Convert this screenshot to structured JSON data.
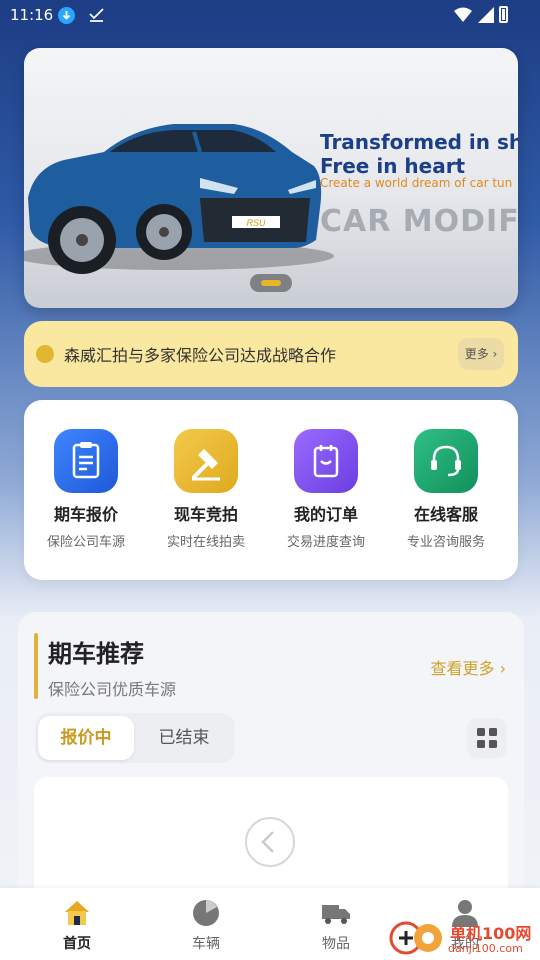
{
  "status_bar": {
    "time": "11:16"
  },
  "banner": {
    "title_line1": "Transformed in shap",
    "title_line2": "Free in heart",
    "subtitle": "Create a world dream of car tun",
    "watermark": "CAR MODIFIC",
    "plate": "RSU"
  },
  "notice": {
    "text": "森威汇拍与多家保险公司达成战略合作",
    "more": "更多 ›"
  },
  "quick_actions": [
    {
      "title": "期车报价",
      "subtitle": "保险公司车源",
      "icon": "clipboard-quote-icon",
      "color": "#2f6ff0"
    },
    {
      "title": "现车竞拍",
      "subtitle": "实时在线拍卖",
      "icon": "auction-hammer-icon",
      "color": "#e7b52f"
    },
    {
      "title": "我的订单",
      "subtitle": "交易进度查询",
      "icon": "order-list-icon",
      "color": "#7a48e8"
    },
    {
      "title": "在线客服",
      "subtitle": "专业咨询服务",
      "icon": "headset-icon",
      "color": "#18a06e"
    }
  ],
  "recommend": {
    "title": "期车推荐",
    "subtitle": "保险公司优质车源",
    "more": "查看更多 ›",
    "tabs": [
      "报价中",
      "已结束"
    ],
    "active_tab": 0
  },
  "bottom_nav": [
    {
      "label": "首页",
      "icon": "home-icon",
      "active": true
    },
    {
      "label": "车辆",
      "icon": "pie-chart-icon",
      "active": false
    },
    {
      "label": "物品",
      "icon": "truck-icon",
      "active": false
    },
    {
      "label": "我的",
      "icon": "user-icon",
      "active": false
    }
  ],
  "site_watermark": {
    "text": "单机100网",
    "url": "danji100.com"
  },
  "colors": {
    "accent": "#e1b23a",
    "brand_blue": "#1c3f8a"
  }
}
